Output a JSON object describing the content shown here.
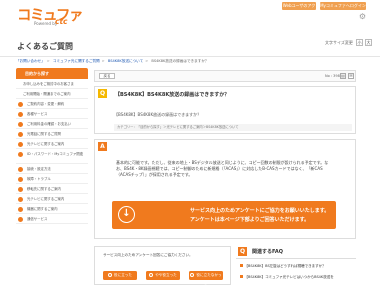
{
  "header": {
    "logo": "コミュファ",
    "logo_sub": "Powered by",
    "logo_brand": "ctc",
    "btn_web": "Webユーザのアクセス",
    "btn_my": "Myコミュファへログイン",
    "gear_icon": "gear-icon"
  },
  "page_title": "よくあるご質問",
  "font_size": {
    "label": "文字サイズ変更",
    "small": "小",
    "large": "大"
  },
  "breadcrumb": [
    "「お問い合わせ」",
    "コミュファ光に関するご質問",
    "BS4K8K放送について",
    "BS4K8K放送の録画はできますか？"
  ],
  "sidebar": {
    "header": "目的から探す",
    "items": [
      {
        "label": "お申し込みをご検討中のお客さま",
        "type": "top"
      },
      {
        "label": "ご利用開始・開通までのご案内",
        "type": "top"
      },
      {
        "label": "ご契約内容・変更・解約",
        "type": "dot"
      },
      {
        "label": "各種サービス",
        "type": "dot"
      },
      {
        "label": "ご利用料金の確認・お支払い",
        "type": "dot"
      },
      {
        "label": "光電話に関するご質問",
        "type": "dot"
      },
      {
        "label": "光テレビに関するご案内",
        "type": "dot"
      },
      {
        "label": "ID・パスワード・Myコミュファ関連",
        "type": "dot"
      },
      {
        "label": "接続・設定方法",
        "type": "dot"
      },
      {
        "label": "故障・トラブル",
        "type": "dot"
      },
      {
        "label": "移転先に関するご案内",
        "type": "dot"
      },
      {
        "label": "光テレビに関するご案内",
        "type": "dot"
      },
      {
        "label": "機器に関するご案内",
        "type": "dot"
      },
      {
        "label": "通信サービス",
        "type": "dot"
      }
    ]
  },
  "toolbar": {
    "back": "戻る",
    "page_no": "No : 3981",
    "print_icon": "print-icon",
    "share_icon": "share-icon"
  },
  "question": {
    "badge": "Q",
    "title": "【BS4K8K】BS4K8K放送の録画はできますか？",
    "detail": "【BS4K8K】BS4K8K放送の録画はできますか？",
    "category": "カテゴリー：「目的から探す」＞光テレビに関するご案内＞BS4K8K放送について"
  },
  "answer": {
    "badge": "A",
    "text": "基本的に可能です。ただし、従来の地上・BSデジタル放送と同じように、コピー回数の制限が設けられる予定です。なお、BS4K・8K録画視聴では、コピー制御のために新規格（「ACAS」）に対応したB-CASカードではなく、「新CAS（ACASチップ）」が採用される予定です。",
    "survey_icon": "download-icon",
    "survey_line1": "サービス向上のためアンケートにご協力をお願いいたします。",
    "survey_line2": "アンケートは本ページ下部よりご回答いただけます。"
  },
  "rating": {
    "question": "サービス向上のためアンケート回答にご協力ください。",
    "buttons": [
      "役に立った",
      "やや役立った",
      "役に立たなかった"
    ]
  },
  "related": {
    "badge": "Q",
    "title": "関連するFAQ",
    "items": [
      "【BS4K8K】BS左旋はどうすれば視聴できますか？",
      "【BS4K8K】コミュファ光テレビはいつからBS4K放送を"
    ]
  }
}
